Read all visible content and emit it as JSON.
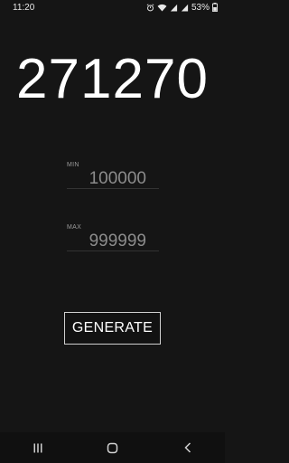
{
  "status_bar": {
    "time": "11:20",
    "battery_percent": "53%",
    "icons": [
      "alarm-icon",
      "wifi-icon",
      "signal-icon",
      "signal-icon",
      "battery-icon"
    ]
  },
  "result": {
    "value": "271270"
  },
  "min_field": {
    "label": "MIN",
    "placeholder": "100000"
  },
  "max_field": {
    "label": "MAX",
    "placeholder": "999999"
  },
  "generate_button": {
    "label": "GENERATE"
  },
  "nav_bar": {
    "icons": [
      "recent-apps-icon",
      "home-icon",
      "back-icon"
    ]
  }
}
